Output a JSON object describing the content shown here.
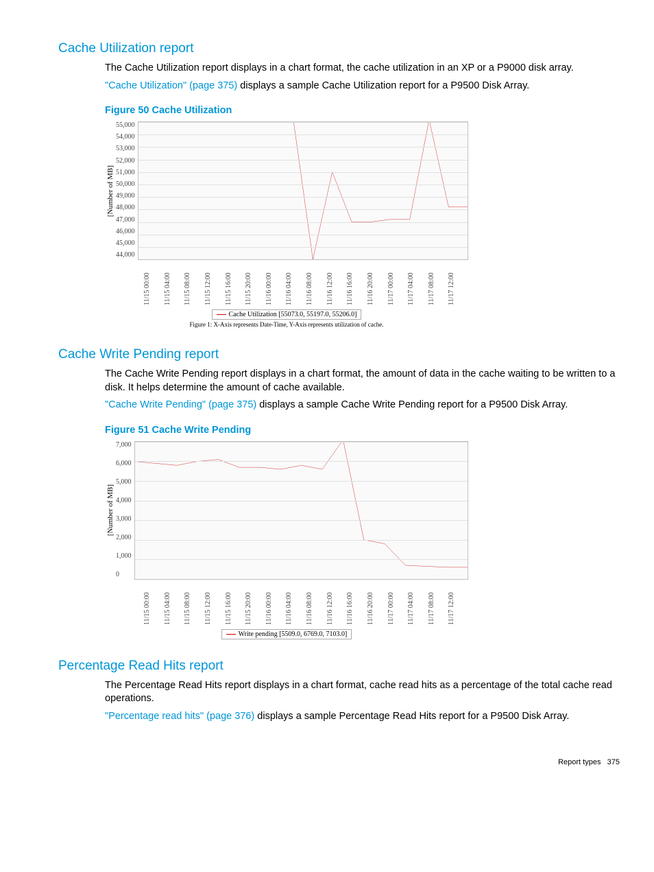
{
  "sections": {
    "s1": {
      "title": "Cache Utilization report"
    },
    "s2": {
      "title": "Cache Write Pending report"
    },
    "s3": {
      "title": "Percentage Read Hits report"
    }
  },
  "text": {
    "s1p1": "The Cache Utilization report displays in a chart format, the cache utilization in an XP or a P9000 disk array.",
    "s1link": "\"Cache Utilization\" (page 375)",
    "s1p2a": " displays a sample Cache Utilization report for a P9500 Disk Array.",
    "s2p1": "The Cache Write Pending report displays in a chart format, the amount of data in the cache waiting to be written to a disk. It helps determine the amount of cache available.",
    "s2link": "\"Cache Write Pending\" (page 375)",
    "s2p2a": " displays a sample Cache Write Pending report for a P9500 Disk Array.",
    "s3p1": "The Percentage Read Hits report displays in a chart format, cache read hits as a percentage of the total cache read operations.",
    "s3link": "\"Percentage read hits\" (page 376)",
    "s3p2a": " displays a sample Percentage Read Hits report for a P9500 Disk Array."
  },
  "fig50": {
    "title": "Figure 50 Cache Utilization"
  },
  "fig51": {
    "title": "Figure 51 Cache Write Pending"
  },
  "footer": {
    "label": "Report types",
    "page": "375"
  },
  "chart_data": [
    {
      "id": "fig50",
      "type": "line",
      "title": "Cache Utilization",
      "ylabel": "[Number of MB]",
      "xlabel": "",
      "ylim": [
        44000,
        55000
      ],
      "yticks": [
        55000,
        54000,
        53000,
        52000,
        51000,
        50000,
        49000,
        48000,
        47000,
        46000,
        45000,
        44000
      ],
      "xticks": [
        "11/15 00:00",
        "11/15 04:00",
        "11/15 08:00",
        "11/15 12:00",
        "11/15 16:00",
        "11/15 20:00",
        "11/16 00:00",
        "11/16 04:00",
        "11/16 08:00",
        "11/16 12:00",
        "11/16 16:00",
        "11/16 20:00",
        "11/17 00:00",
        "11/17 04:00",
        "11/17 08:00",
        "11/17 12:00"
      ],
      "legend": "Cache Utilization   [55073.0, 55197.0, 55206.0]",
      "caption": "Figure 1: X-Axis represents Date-Time, Y-Axis represents utilization of cache.",
      "series": [
        {
          "name": "Cache Utilization",
          "x": [
            "11/15 00:00",
            "11/15 04:00",
            "11/15 08:00",
            "11/15 12:00",
            "11/15 16:00",
            "11/15 20:00",
            "11/16 00:00",
            "11/16 04:00",
            "11/16 08:00",
            "11/16 10:00",
            "11/16 12:00",
            "11/16 16:00",
            "11/16 20:00",
            "11/17 00:00",
            "11/17 04:00",
            "11/17 06:00",
            "11/17 08:00",
            "11/17 12:00"
          ],
          "y": [
            55100,
            55100,
            55100,
            55100,
            55150,
            55150,
            55100,
            55100,
            55100,
            44000,
            51000,
            47000,
            47000,
            47200,
            47200,
            55200,
            48200,
            48200
          ]
        }
      ]
    },
    {
      "id": "fig51",
      "type": "line",
      "title": "Cache Write Pending",
      "ylabel": "[Number of MB]",
      "xlabel": "",
      "ylim": [
        0,
        7000
      ],
      "yticks": [
        7000,
        6000,
        5000,
        4000,
        3000,
        2000,
        1000,
        0
      ],
      "xticks": [
        "11/15 00:00",
        "11/15 04:00",
        "11/15 08:00",
        "11/15 12:00",
        "11/15 16:00",
        "11/15 20:00",
        "11/16 00:00",
        "11/16 04:00",
        "11/16 08:00",
        "11/16 12:00",
        "11/16 16:00",
        "11/16 20:00",
        "11/17 00:00",
        "11/17 04:00",
        "11/17 08:00",
        "11/17 12:00"
      ],
      "legend": "Write pending   [5509.0, 6769.0, 7103.0]",
      "caption": "",
      "series": [
        {
          "name": "Write pending",
          "x": [
            "11/15 00:00",
            "11/15 04:00",
            "11/15 08:00",
            "11/15 12:00",
            "11/15 16:00",
            "11/15 20:00",
            "11/16 00:00",
            "11/16 04:00",
            "11/16 08:00",
            "11/16 12:00",
            "11/16 16:00",
            "11/16 18:00",
            "11/16 20:00",
            "11/17 00:00",
            "11/17 04:00",
            "11/17 08:00",
            "11/17 12:00"
          ],
          "y": [
            6000,
            5900,
            5800,
            6000,
            6100,
            5700,
            5700,
            5600,
            5800,
            5600,
            7100,
            2000,
            1800,
            700,
            650,
            600,
            600
          ]
        }
      ]
    }
  ]
}
